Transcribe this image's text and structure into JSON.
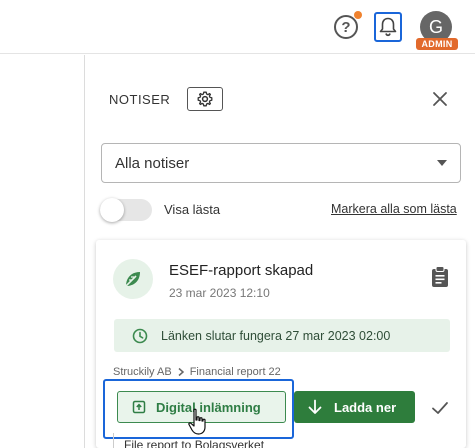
{
  "header": {
    "help_label": "?",
    "avatar_initial": "G",
    "admin_badge": "ADMIN",
    "colors": {
      "notif_dot": "#f0822e",
      "focus_outline": "#1a66d9",
      "admin_badge": "#e26a2c"
    }
  },
  "panel": {
    "title": "NOTISER",
    "filter": {
      "selected": "Alla notiser"
    },
    "show_read_label": "Visa lästa",
    "show_read_enabled": false,
    "mark_all_label": "Markera alla som lästa"
  },
  "notification": {
    "title": "ESEF-rapport skapad",
    "timestamp": "23 mar 2023 12:10",
    "info_text": "Länken slutar fungera 27 mar 2023 02:00",
    "breadcrumb": [
      "Struckily AB",
      "Financial report 22"
    ],
    "digital_button_label": "Digital inlämning",
    "download_button_label": "Ladda ner",
    "colors": {
      "primary_green": "#2e7d3c",
      "info_bg": "#e7f2e9"
    }
  },
  "next_notification": {
    "title": "File report to Bolagsverket"
  },
  "icons": {
    "help": "help-circle-icon",
    "bell": "bell-icon",
    "settings": "gear-icon",
    "close": "close-icon",
    "dropdown": "caret-down-icon",
    "card": "leaf-icon",
    "clipboard": "clipboard-icon",
    "clock": "clock-icon",
    "chevron": "chevron-right-icon",
    "upload": "upload-box-icon",
    "download": "arrow-down-icon",
    "check": "check-icon",
    "cursor": "hand-pointer-icon"
  }
}
